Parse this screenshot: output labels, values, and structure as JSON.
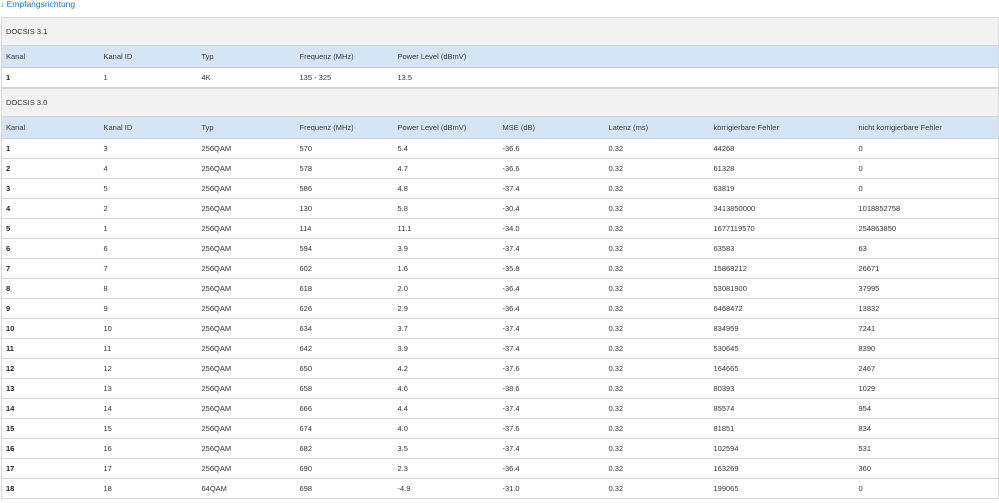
{
  "link": {
    "label": "↓ Empfangsrichtung"
  },
  "docsis31": {
    "title": "DOCSIS 3.1",
    "headers": [
      "Kanal",
      "Kanal ID",
      "Typ",
      "Frequenz (MHz)",
      "Power Level (dBmV)",
      "",
      "",
      "",
      ""
    ],
    "rows": [
      [
        "1",
        "1",
        "4K",
        "135 - 325",
        "13.5",
        "",
        "",
        "",
        ""
      ]
    ]
  },
  "docsis30": {
    "title": "DOCSIS 3.0",
    "headers": [
      "Kanal",
      "Kanal ID",
      "Typ",
      "Frequenz (MHz)",
      "Power Level (dBmV)",
      "MSE (dB)",
      "Latenz (ms)",
      "korrigierbare Fehler",
      "nicht korrigierbare Fehler"
    ],
    "rows": [
      [
        "1",
        "3",
        "256QAM",
        "570",
        "5.4",
        "-36.6",
        "0.32",
        "44268",
        "0"
      ],
      [
        "2",
        "4",
        "256QAM",
        "578",
        "4.7",
        "-36.6",
        "0.32",
        "61328",
        "0"
      ],
      [
        "3",
        "5",
        "256QAM",
        "586",
        "4.8",
        "-37.4",
        "0.32",
        "63819",
        "0"
      ],
      [
        "4",
        "2",
        "256QAM",
        "130",
        "5.8",
        "-30.4",
        "0.32",
        "3413850000",
        "1018852758"
      ],
      [
        "5",
        "1",
        "256QAM",
        "114",
        "11.1",
        "-34.0",
        "0.32",
        "1677119570",
        "254863850"
      ],
      [
        "6",
        "6",
        "256QAM",
        "594",
        "3.9",
        "-37.4",
        "0.32",
        "63583",
        "63"
      ],
      [
        "7",
        "7",
        "256QAM",
        "602",
        "1.6",
        "-35.8",
        "0.32",
        "15868212",
        "26671"
      ],
      [
        "8",
        "8",
        "256QAM",
        "618",
        "2.0",
        "-36.4",
        "0.32",
        "53081900",
        "37995"
      ],
      [
        "9",
        "9",
        "256QAM",
        "626",
        "2.9",
        "-36.4",
        "0.32",
        "6468472",
        "13832"
      ],
      [
        "10",
        "10",
        "256QAM",
        "634",
        "3.7",
        "-37.4",
        "0.32",
        "834959",
        "7241"
      ],
      [
        "11",
        "11",
        "256QAM",
        "642",
        "3.9",
        "-37.4",
        "0.32",
        "530645",
        "8390"
      ],
      [
        "12",
        "12",
        "256QAM",
        "650",
        "4.2",
        "-37.6",
        "0.32",
        "164665",
        "2467"
      ],
      [
        "13",
        "13",
        "256QAM",
        "658",
        "4.6",
        "-38.6",
        "0.32",
        "80393",
        "1029"
      ],
      [
        "14",
        "14",
        "256QAM",
        "666",
        "4.4",
        "-37.4",
        "0.32",
        "85574",
        "954"
      ],
      [
        "15",
        "15",
        "256QAM",
        "674",
        "4.0",
        "-37.6",
        "0.32",
        "81851",
        "834"
      ],
      [
        "16",
        "16",
        "256QAM",
        "682",
        "3.5",
        "-37.4",
        "0.32",
        "102594",
        "531"
      ],
      [
        "17",
        "17",
        "256QAM",
        "690",
        "2.3",
        "-36.4",
        "0.32",
        "163269",
        "360"
      ],
      [
        "18",
        "18",
        "64QAM",
        "698",
        "-4.9",
        "-31.0",
        "0.32",
        "199065",
        "0"
      ]
    ]
  }
}
